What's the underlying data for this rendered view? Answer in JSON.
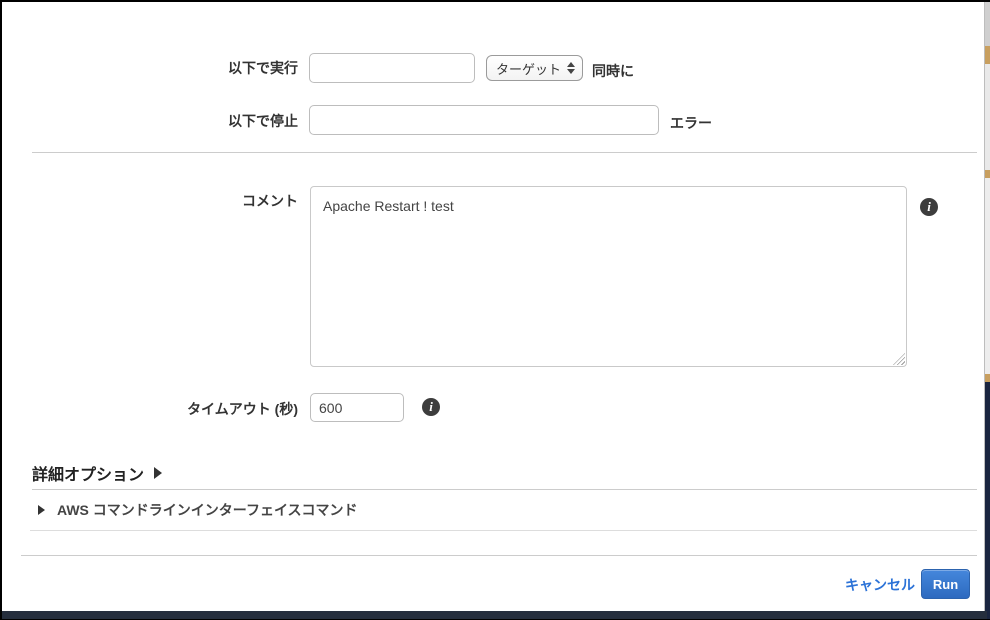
{
  "dialog": {
    "rows": {
      "run": {
        "label": "以下で実行",
        "value": "",
        "target_select": "ターゲット",
        "suffix": "同時に"
      },
      "stop": {
        "label": "以下で停止",
        "value": "",
        "suffix": "エラー"
      },
      "comment": {
        "label": "コメント",
        "value": "Apache Restart ! test"
      },
      "timeout": {
        "label": "タイムアウト (秒)",
        "value": "600"
      }
    },
    "sections": {
      "advanced": "詳細オプション",
      "cli": "AWS コマンドラインインターフェイスコマンド"
    },
    "footer": {
      "cancel": "キャンセル",
      "run": "Run"
    },
    "icons": {
      "info_glyph": "i"
    },
    "colors": {
      "link_blue": "#2b72d7",
      "run_button_top": "#4587dc",
      "run_button_bottom": "#2d6ac0",
      "console_footer_bar": "#252e3d",
      "console_accent_tan": "#c89f5f",
      "console_sidebar_navy": "#1a2540"
    }
  }
}
